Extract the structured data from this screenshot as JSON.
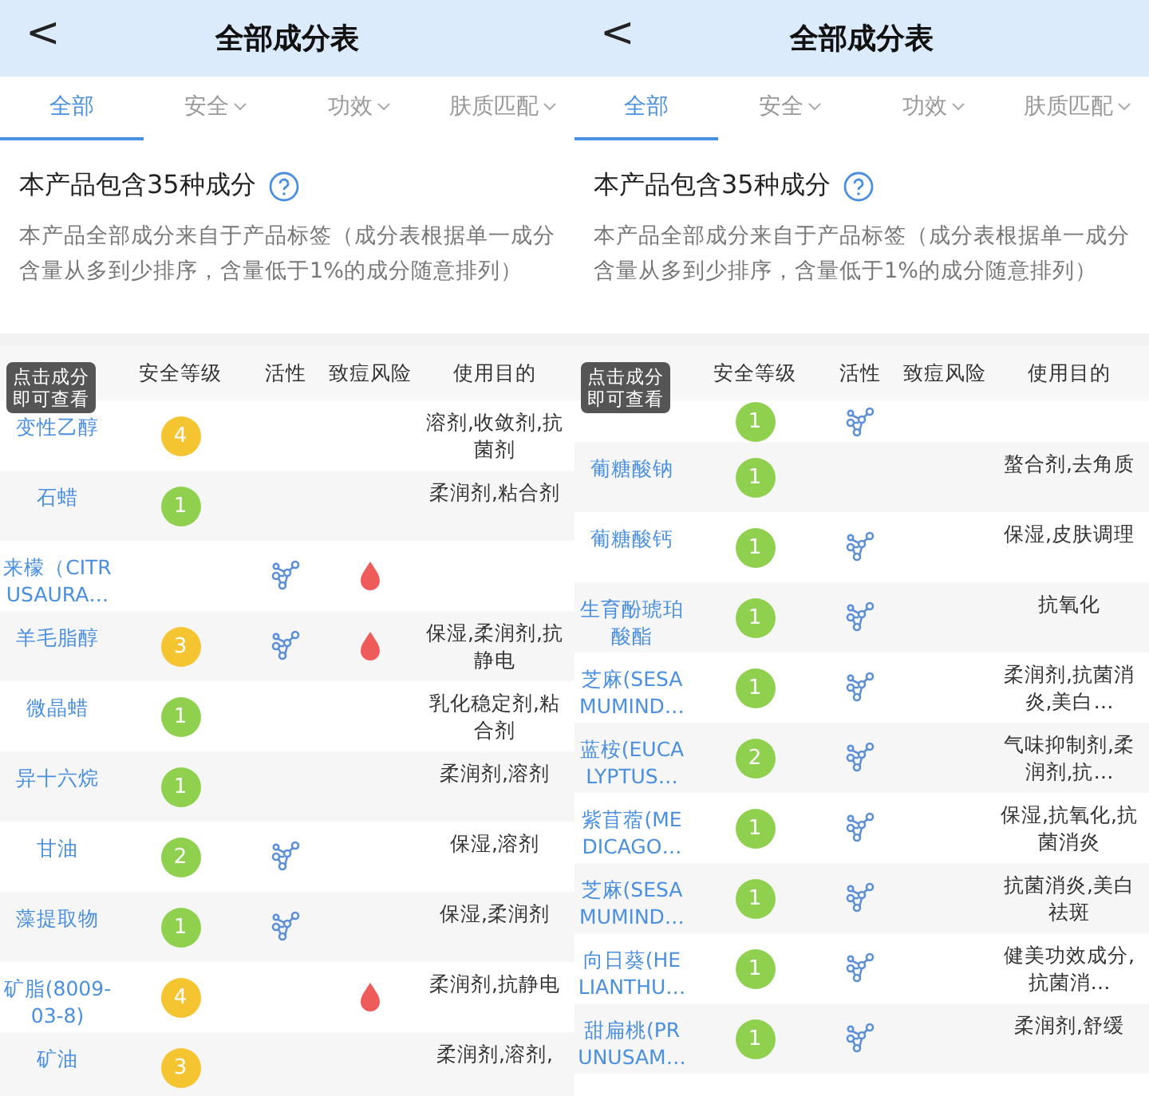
{
  "panels": [
    {
      "back": "<",
      "title": "全部成分表",
      "tabs": [
        {
          "label": "全部",
          "selected": true,
          "dropdown": false
        },
        {
          "label": "安全",
          "selected": false,
          "dropdown": true
        },
        {
          "label": "功效",
          "selected": false,
          "dropdown": true
        },
        {
          "label": "肤质匹配",
          "selected": false,
          "dropdown": true
        }
      ],
      "summary": "本产品包含35种成分",
      "description": "本产品全部成分来自于产品标签（成分表根据单一成分含量从多到少排序，含量低于1%的成分随意排列）",
      "columns": [
        "安全等级",
        "活性",
        "致痘风险",
        "使用目的"
      ],
      "tooltip": "点击成分即可查看",
      "rows": [
        {
          "name": "变性乙醇",
          "grade": "4",
          "color": "#f5c431",
          "active": false,
          "acne": false,
          "purpose": "溶剂,收敛剂,抗菌剂"
        },
        {
          "name": "石蜡",
          "grade": "1",
          "color": "#8fd14f",
          "active": false,
          "acne": false,
          "purpose": "柔润剂,粘合剂"
        },
        {
          "name": "来檬（CITRUSAURA…",
          "active": true,
          "acne": true
        },
        {
          "name": "羊毛脂醇",
          "grade": "3",
          "color": "#f5c431",
          "active": true,
          "acne": true,
          "purpose": "保湿,柔润剂,抗静电"
        },
        {
          "name": "微晶蜡",
          "grade": "1",
          "color": "#8fd14f",
          "active": false,
          "acne": false,
          "purpose": "乳化稳定剂,粘合剂"
        },
        {
          "name": "异十六烷",
          "grade": "1",
          "color": "#8fd14f",
          "active": false,
          "acne": false,
          "purpose": "柔润剂,溶剂"
        },
        {
          "name": "甘油",
          "grade": "2",
          "color": "#8fd14f",
          "active": true,
          "acne": false,
          "purpose": "保湿,溶剂"
        },
        {
          "name": "藻提取物",
          "grade": "1",
          "color": "#8fd14f",
          "active": true,
          "acne": false,
          "purpose": "保湿,柔润剂"
        },
        {
          "name": "矿脂(8009-03-8)",
          "grade": "4",
          "color": "#f5c431",
          "active": false,
          "acne": true,
          "purpose": "柔润剂,抗静电"
        },
        {
          "name": "矿油",
          "grade": "3",
          "color": "#f5c431",
          "active": false,
          "acne": false,
          "purpose": "柔润剂,溶剂,"
        }
      ]
    },
    {
      "back": "<",
      "title": "全部成分表",
      "tabs": [
        {
          "label": "全部",
          "selected": true,
          "dropdown": false
        },
        {
          "label": "安全",
          "selected": false,
          "dropdown": true
        },
        {
          "label": "功效",
          "selected": false,
          "dropdown": true
        },
        {
          "label": "肤质匹配",
          "selected": false,
          "dropdown": true
        }
      ],
      "summary": "本产品包含35种成分",
      "description": "本产品全部成分来自于产品标签（成分表根据单一成分含量从多到少排序，含量低于1%的成分随意排列）",
      "columns": [
        "安全等级",
        "活性",
        "致痘风险",
        "使用目的"
      ],
      "tooltip": "点击成分即可查看",
      "rows": [
        {
          "partial": true,
          "grade": "1",
          "color": "#8fd14f",
          "active": true,
          "acne": false
        },
        {
          "name": "葡糖酸钠",
          "grade": "1",
          "color": "#8fd14f",
          "active": false,
          "acne": false,
          "purpose": "螯合剂,去角质"
        },
        {
          "name": "葡糖酸钙",
          "grade": "1",
          "color": "#8fd14f",
          "active": true,
          "acne": false,
          "purpose": "保湿,皮肤调理"
        },
        {
          "name": "生育酚琥珀酸酯",
          "grade": "1",
          "color": "#8fd14f",
          "active": true,
          "acne": false,
          "purpose": "抗氧化"
        },
        {
          "name": "芝麻(SESAMUMIND…",
          "grade": "1",
          "color": "#8fd14f",
          "active": true,
          "acne": false,
          "purpose": "柔润剂,抗菌消炎,美白…"
        },
        {
          "name": "蓝桉(EUCALYPTUS…",
          "grade": "2",
          "color": "#8fd14f",
          "active": true,
          "acne": false,
          "purpose": "气味抑制剂,柔润剂,抗…"
        },
        {
          "name": "紫苜蓿(MEDICAGO…",
          "grade": "1",
          "color": "#8fd14f",
          "active": true,
          "acne": false,
          "purpose": "保湿,抗氧化,抗菌消炎"
        },
        {
          "name": "芝麻(SESAMUMIND…",
          "grade": "1",
          "color": "#8fd14f",
          "active": true,
          "acne": false,
          "purpose": "抗菌消炎,美白祛斑"
        },
        {
          "name": "向日葵(HELIANTHU…",
          "grade": "1",
          "color": "#8fd14f",
          "active": true,
          "acne": false,
          "purpose": "健美功效成分,抗菌消…"
        },
        {
          "name": "甜扁桃(PRUNUSAM…",
          "grade": "1",
          "color": "#8fd14f",
          "active": true,
          "acne": false,
          "purpose": "柔润剂,舒缓"
        }
      ]
    }
  ]
}
